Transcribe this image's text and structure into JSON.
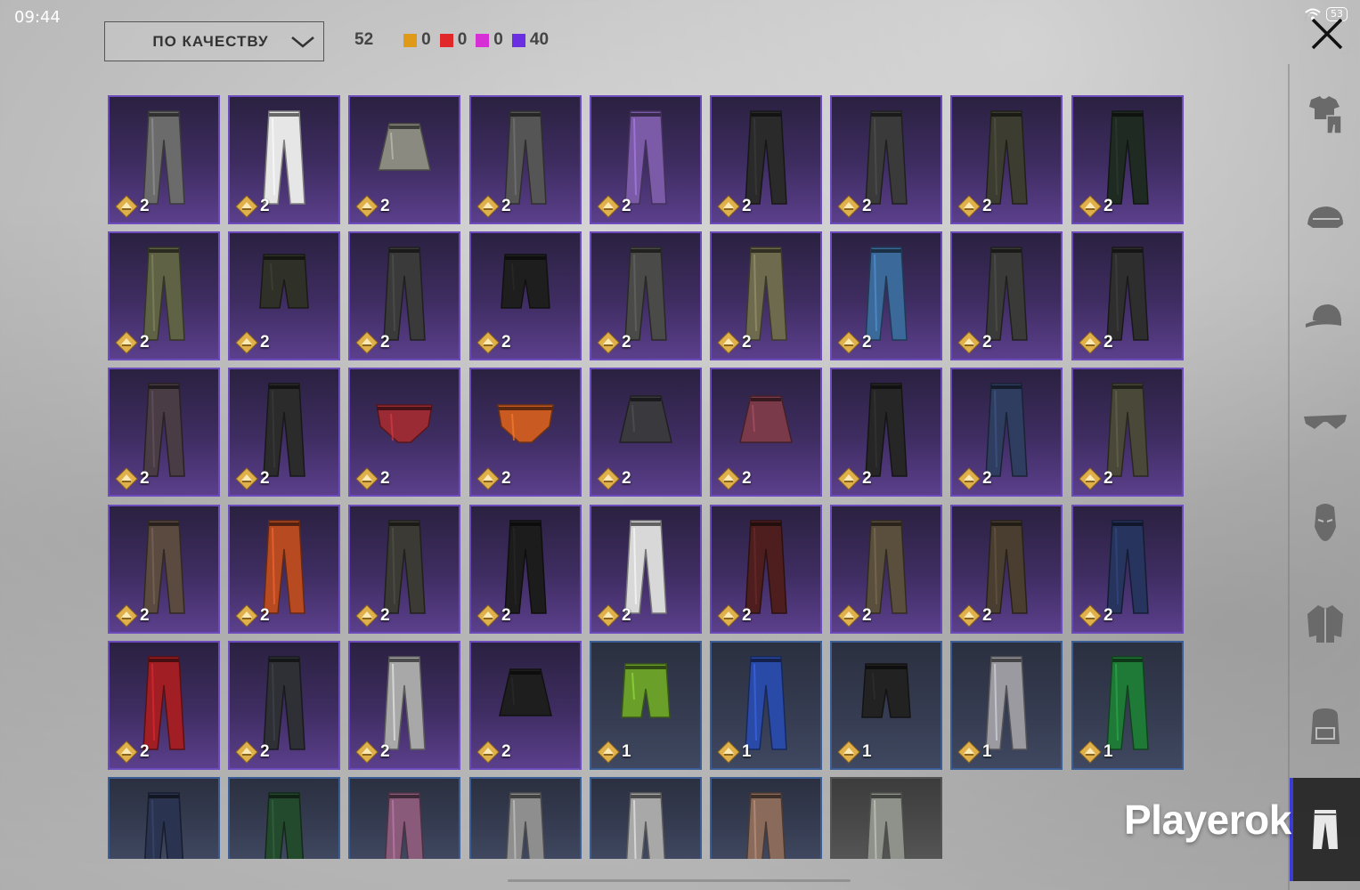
{
  "status": {
    "time": "09:44",
    "battery": "53"
  },
  "sort": {
    "label": "ПО КАЧЕСТВУ"
  },
  "counts": {
    "total": "52",
    "tiers": [
      {
        "name": "gold",
        "color": "#e09a1a",
        "value": "0"
      },
      {
        "name": "red",
        "color": "#e0282a",
        "value": "0"
      },
      {
        "name": "pink",
        "color": "#d62fd6",
        "value": "0"
      },
      {
        "name": "purple",
        "color": "#6a2fe0",
        "value": "40"
      }
    ]
  },
  "rail": {
    "icons": [
      "shirt-icon",
      "helmet-icon",
      "cap-icon",
      "glasses-icon",
      "mask-icon",
      "jacket-icon",
      "backpack-icon",
      "pants-icon"
    ],
    "active": "pants-icon"
  },
  "watermark": "Playerok",
  "items": [
    {
      "type": "pants",
      "tier": "epic",
      "qty": "2",
      "color": "#6b6b6b"
    },
    {
      "type": "pants",
      "tier": "epic",
      "qty": "2",
      "color": "#e6e6e6"
    },
    {
      "type": "skirt",
      "tier": "epic",
      "qty": "2",
      "color": "#8a8a80"
    },
    {
      "type": "pants",
      "tier": "epic",
      "qty": "2",
      "color": "#555555"
    },
    {
      "type": "pants",
      "tier": "epic",
      "qty": "2",
      "color": "#7b5aa8"
    },
    {
      "type": "pants",
      "tier": "epic",
      "qty": "2",
      "color": "#2a2a2a"
    },
    {
      "type": "pants",
      "tier": "epic",
      "qty": "2",
      "color": "#3a3a3a"
    },
    {
      "type": "pants",
      "tier": "epic",
      "qty": "2",
      "color": "#3c3c30"
    },
    {
      "type": "pants",
      "tier": "epic",
      "qty": "2",
      "color": "#1f2a22"
    },
    {
      "type": "pants",
      "tier": "epic",
      "qty": "2",
      "color": "#5f6244"
    },
    {
      "type": "shorts",
      "tier": "epic",
      "qty": "2",
      "color": "#2f3028"
    },
    {
      "type": "pants",
      "tier": "epic",
      "qty": "2",
      "color": "#3a3a3a"
    },
    {
      "type": "shorts",
      "tier": "epic",
      "qty": "2",
      "color": "#1e1e1e"
    },
    {
      "type": "pants",
      "tier": "epic",
      "qty": "2",
      "color": "#4a4a48"
    },
    {
      "type": "pants",
      "tier": "epic",
      "qty": "2",
      "color": "#6e6a4e"
    },
    {
      "type": "pants",
      "tier": "epic",
      "qty": "2",
      "color": "#3b6a9a"
    },
    {
      "type": "pants",
      "tier": "epic",
      "qty": "2",
      "color": "#3a3a38"
    },
    {
      "type": "pants",
      "tier": "epic",
      "qty": "2",
      "color": "#2e2e2e"
    },
    {
      "type": "pants",
      "tier": "epic",
      "qty": "2",
      "color": "#4a3c44"
    },
    {
      "type": "pants",
      "tier": "epic",
      "qty": "2",
      "color": "#2b2b2b"
    },
    {
      "type": "briefs",
      "tier": "epic",
      "qty": "2",
      "color": "#9a2a33"
    },
    {
      "type": "briefs",
      "tier": "epic",
      "qty": "2",
      "color": "#c85a22"
    },
    {
      "type": "skirt",
      "tier": "epic",
      "qty": "2",
      "color": "#3a3a3e"
    },
    {
      "type": "skirt",
      "tier": "epic",
      "qty": "2",
      "color": "#7a3a4a"
    },
    {
      "type": "pants",
      "tier": "epic",
      "qty": "2",
      "color": "#262626"
    },
    {
      "type": "pants",
      "tier": "epic",
      "qty": "2",
      "color": "#2f3e60"
    },
    {
      "type": "pants",
      "tier": "epic",
      "qty": "2",
      "color": "#4a4838"
    },
    {
      "type": "pants",
      "tier": "epic",
      "qty": "2",
      "color": "#5a4a40"
    },
    {
      "type": "pants",
      "tier": "epic",
      "qty": "2",
      "color": "#b84a22"
    },
    {
      "type": "pants",
      "tier": "epic",
      "qty": "2",
      "color": "#3b3a34"
    },
    {
      "type": "pants",
      "tier": "epic",
      "qty": "2",
      "color": "#1c1c1c"
    },
    {
      "type": "pants",
      "tier": "epic",
      "qty": "2",
      "color": "#d8d8d8"
    },
    {
      "type": "pants",
      "tier": "epic",
      "qty": "2",
      "color": "#4e1e1e"
    },
    {
      "type": "pants",
      "tier": "epic",
      "qty": "2",
      "color": "#5a4e3c"
    },
    {
      "type": "pants",
      "tier": "epic",
      "qty": "2",
      "color": "#4a3e30"
    },
    {
      "type": "pants",
      "tier": "epic",
      "qty": "2",
      "color": "#26345e"
    },
    {
      "type": "pants",
      "tier": "epic",
      "qty": "2",
      "color": "#a01e24"
    },
    {
      "type": "pants",
      "tier": "epic",
      "qty": "2",
      "color": "#2e3036"
    },
    {
      "type": "pants",
      "tier": "epic",
      "qty": "2",
      "color": "#a8a8a8"
    },
    {
      "type": "skirt",
      "tier": "epic",
      "qty": "2",
      "color": "#1e1e1e"
    },
    {
      "type": "shorts",
      "tier": "rare",
      "qty": "1",
      "color": "#6aa02a"
    },
    {
      "type": "pants",
      "tier": "rare",
      "qty": "1",
      "color": "#2a4aa8"
    },
    {
      "type": "shorts",
      "tier": "rare",
      "qty": "1",
      "color": "#222222"
    },
    {
      "type": "pants",
      "tier": "rare",
      "qty": "1",
      "color": "#9a9aa0"
    },
    {
      "type": "pants",
      "tier": "rare",
      "qty": "1",
      "color": "#1e7a36"
    },
    {
      "type": "pants",
      "tier": "rare",
      "qty": "",
      "color": "#2a3450"
    },
    {
      "type": "pants",
      "tier": "rare",
      "qty": "",
      "color": "#244a2e"
    },
    {
      "type": "pants",
      "tier": "rare",
      "qty": "",
      "color": "#8a5a7a"
    },
    {
      "type": "pants",
      "tier": "rare",
      "qty": "",
      "color": "#8e8e8e"
    },
    {
      "type": "pants",
      "tier": "rare",
      "qty": "",
      "color": "#a8a8a8"
    },
    {
      "type": "pants",
      "tier": "rare",
      "qty": "",
      "color": "#8a6a5a"
    },
    {
      "type": "pants",
      "tier": "common",
      "qty": "",
      "color": "#8e928a"
    }
  ]
}
